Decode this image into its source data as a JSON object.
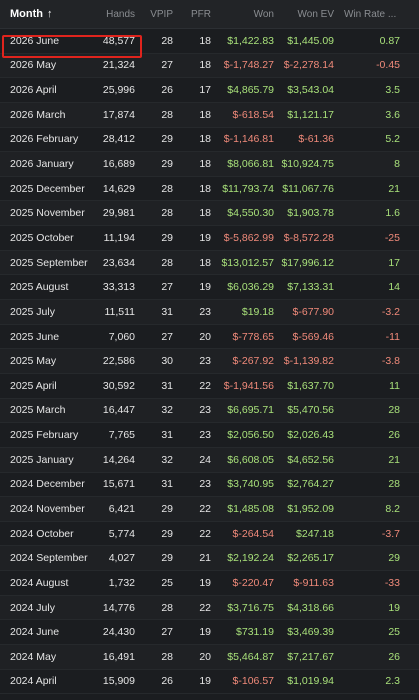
{
  "columns": {
    "month": "Month",
    "hands": "Hands",
    "vpip": "VPIP",
    "pfr": "PFR",
    "won": "Won",
    "won_ev": "Won EV",
    "win_rate": "Win Rate ..."
  },
  "sort_indicator": "↑",
  "selected_row": "2026 June",
  "rows": [
    {
      "month": "2026 June",
      "hands": "48,577",
      "vpip": "28",
      "pfr": "18",
      "won": "$1,422.83",
      "won_ev": "$1,445.09",
      "win_rate": "0.87"
    },
    {
      "month": "2026 May",
      "hands": "21,324",
      "vpip": "27",
      "pfr": "18",
      "won": "$-1,748.27",
      "won_ev": "$-2,278.14",
      "win_rate": "-0.45"
    },
    {
      "month": "2026 April",
      "hands": "25,996",
      "vpip": "26",
      "pfr": "17",
      "won": "$4,865.79",
      "won_ev": "$3,543.04",
      "win_rate": "3.5"
    },
    {
      "month": "2026 March",
      "hands": "17,874",
      "vpip": "28",
      "pfr": "18",
      "won": "$-618.54",
      "won_ev": "$1,121.17",
      "win_rate": "3.6"
    },
    {
      "month": "2026 February",
      "hands": "28,412",
      "vpip": "29",
      "pfr": "18",
      "won": "$-1,146.81",
      "won_ev": "$-61.36",
      "win_rate": "5.2"
    },
    {
      "month": "2026 January",
      "hands": "16,689",
      "vpip": "29",
      "pfr": "18",
      "won": "$8,066.81",
      "won_ev": "$10,924.75",
      "win_rate": "8"
    },
    {
      "month": "2025 December",
      "hands": "14,629",
      "vpip": "28",
      "pfr": "18",
      "won": "$11,793.74",
      "won_ev": "$11,067.76",
      "win_rate": "21"
    },
    {
      "month": "2025 November",
      "hands": "29,981",
      "vpip": "28",
      "pfr": "18",
      "won": "$4,550.30",
      "won_ev": "$1,903.78",
      "win_rate": "1.6"
    },
    {
      "month": "2025 October",
      "hands": "11,194",
      "vpip": "29",
      "pfr": "19",
      "won": "$-5,862.99",
      "won_ev": "$-8,572.28",
      "win_rate": "-25"
    },
    {
      "month": "2025 September",
      "hands": "23,634",
      "vpip": "28",
      "pfr": "18",
      "won": "$13,012.57",
      "won_ev": "$17,996.12",
      "win_rate": "17"
    },
    {
      "month": "2025 August",
      "hands": "33,313",
      "vpip": "27",
      "pfr": "19",
      "won": "$6,036.29",
      "won_ev": "$7,133.31",
      "win_rate": "14"
    },
    {
      "month": "2025 July",
      "hands": "11,511",
      "vpip": "31",
      "pfr": "23",
      "won": "$19.18",
      "won_ev": "$-677.90",
      "win_rate": "-3.2"
    },
    {
      "month": "2025 June",
      "hands": "7,060",
      "vpip": "27",
      "pfr": "20",
      "won": "$-778.65",
      "won_ev": "$-569.46",
      "win_rate": "-11"
    },
    {
      "month": "2025 May",
      "hands": "22,586",
      "vpip": "30",
      "pfr": "23",
      "won": "$-267.92",
      "won_ev": "$-1,139.82",
      "win_rate": "-3.8"
    },
    {
      "month": "2025 April",
      "hands": "30,592",
      "vpip": "31",
      "pfr": "22",
      "won": "$-1,941.56",
      "won_ev": "$1,637.70",
      "win_rate": "11"
    },
    {
      "month": "2025 March",
      "hands": "16,447",
      "vpip": "32",
      "pfr": "23",
      "won": "$6,695.71",
      "won_ev": "$5,470.56",
      "win_rate": "28"
    },
    {
      "month": "2025 February",
      "hands": "7,765",
      "vpip": "31",
      "pfr": "23",
      "won": "$2,056.50",
      "won_ev": "$2,026.43",
      "win_rate": "26"
    },
    {
      "month": "2025 January",
      "hands": "14,264",
      "vpip": "32",
      "pfr": "24",
      "won": "$6,608.05",
      "won_ev": "$4,652.56",
      "win_rate": "21"
    },
    {
      "month": "2024 December",
      "hands": "15,671",
      "vpip": "31",
      "pfr": "23",
      "won": "$3,740.95",
      "won_ev": "$2,764.27",
      "win_rate": "28"
    },
    {
      "month": "2024 November",
      "hands": "6,421",
      "vpip": "29",
      "pfr": "22",
      "won": "$1,485.08",
      "won_ev": "$1,952.09",
      "win_rate": "8.2"
    },
    {
      "month": "2024 October",
      "hands": "5,774",
      "vpip": "29",
      "pfr": "22",
      "won": "$-264.54",
      "won_ev": "$247.18",
      "win_rate": "-3.7"
    },
    {
      "month": "2024 September",
      "hands": "4,027",
      "vpip": "29",
      "pfr": "21",
      "won": "$2,192.24",
      "won_ev": "$2,265.17",
      "win_rate": "29"
    },
    {
      "month": "2024 August",
      "hands": "1,732",
      "vpip": "25",
      "pfr": "19",
      "won": "$-220.47",
      "won_ev": "$-911.63",
      "win_rate": "-33"
    },
    {
      "month": "2024 July",
      "hands": "14,776",
      "vpip": "28",
      "pfr": "22",
      "won": "$3,716.75",
      "won_ev": "$4,318.66",
      "win_rate": "19"
    },
    {
      "month": "2024 June",
      "hands": "24,430",
      "vpip": "27",
      "pfr": "19",
      "won": "$731.19",
      "won_ev": "$3,469.39",
      "win_rate": "25"
    },
    {
      "month": "2024 May",
      "hands": "16,491",
      "vpip": "28",
      "pfr": "20",
      "won": "$5,464.87",
      "won_ev": "$7,217.67",
      "win_rate": "26"
    },
    {
      "month": "2024 April",
      "hands": "15,909",
      "vpip": "26",
      "pfr": "19",
      "won": "$-106.57",
      "won_ev": "$1,019.94",
      "win_rate": "2.3"
    }
  ],
  "colors": {
    "positive": "#a8e07a",
    "negative": "#f08a7a",
    "highlight": "#e0241d",
    "background": "#1b1d20"
  }
}
